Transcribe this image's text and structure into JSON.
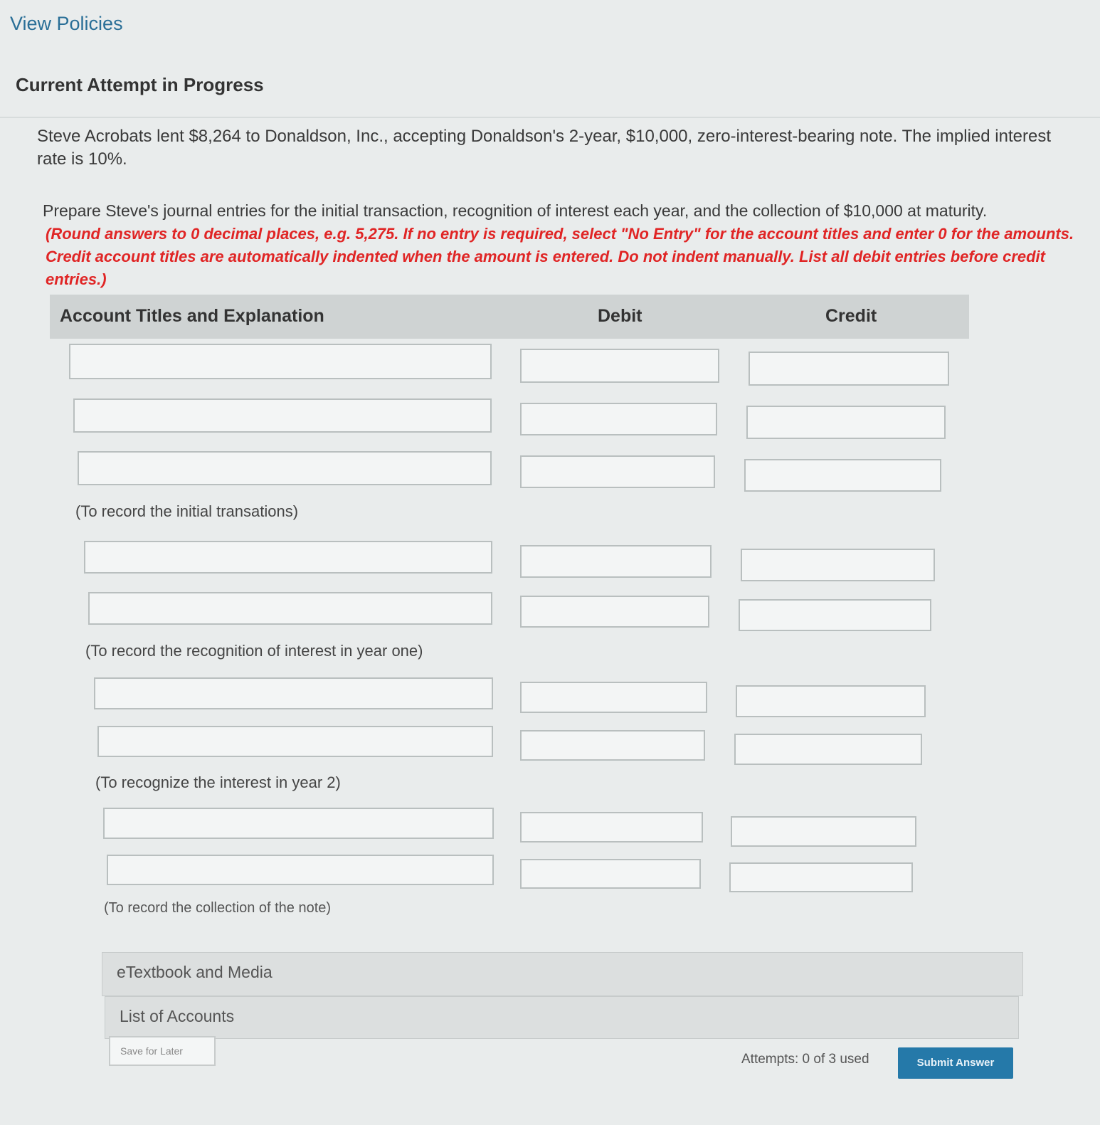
{
  "nav": {
    "view_policies": "View Policies"
  },
  "attempt": {
    "title": "Current Attempt in Progress"
  },
  "problem": {
    "statement": "Steve Acrobats lent $8,264 to Donaldson, Inc., accepting Donaldson's 2-year, $10,000, zero-interest-bearing note. The implied interest rate is 10%.",
    "prepare": "Prepare Steve's journal entries for the initial transaction, recognition of interest each year, and the collection of $10,000 at maturity.",
    "instructions": "(Round answers to 0 decimal places, e.g. 5,275. If no entry is required, select \"No Entry\" for the account titles and enter 0 for the amounts. Credit account titles are automatically indented when the amount is entered. Do not indent manually. List all debit entries before credit entries.)"
  },
  "table": {
    "col_account": "Account Titles and Explanation",
    "col_debit": "Debit",
    "col_credit": "Credit"
  },
  "entries": {
    "note1": "(To record the initial transations)",
    "note2": "(To record the recognition of interest in year one)",
    "note3": "(To recognize the interest in year 2)",
    "note4": "(To record the collection of the note)"
  },
  "resources": {
    "etextbook": "eTextbook and Media",
    "list_accounts": "List of Accounts"
  },
  "footer": {
    "save_label": "Save for Later",
    "attempts": "Attempts: 0 of 3 used",
    "submit_label": "Submit Answer"
  }
}
